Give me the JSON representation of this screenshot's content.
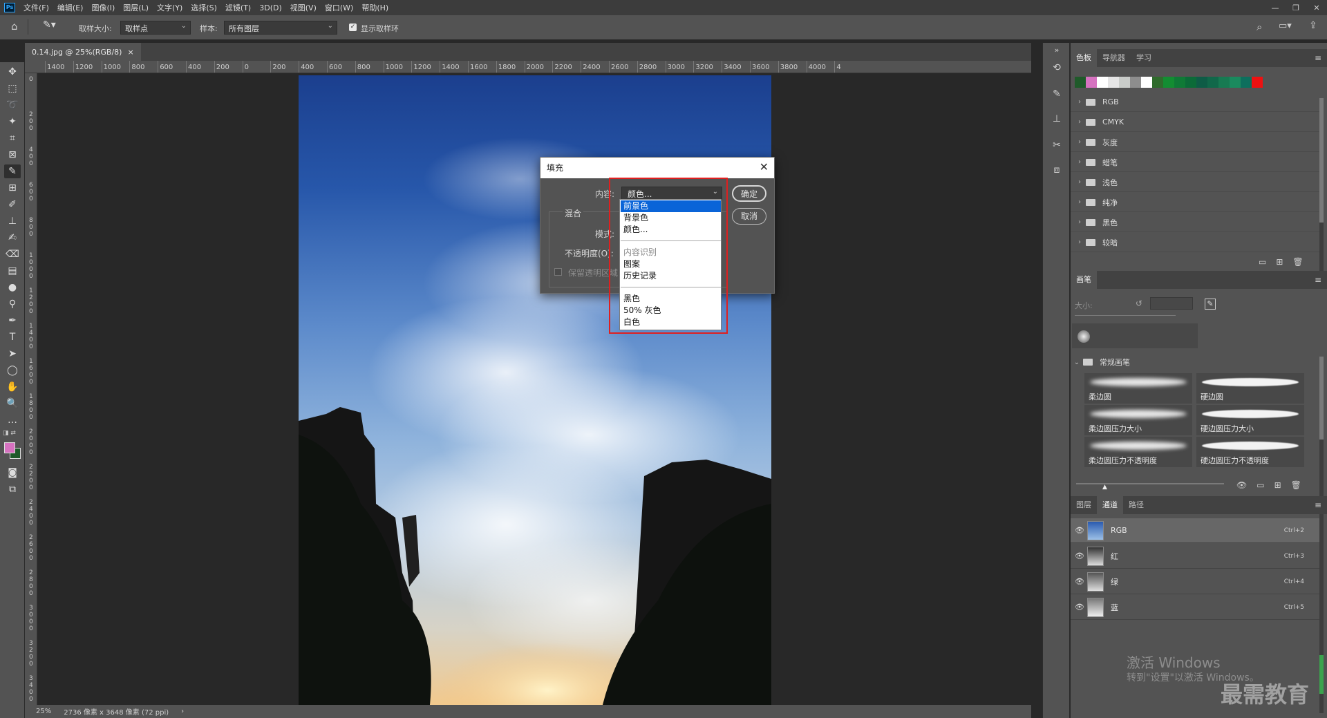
{
  "app": {
    "logo": "Ps"
  },
  "menu": [
    "文件(F)",
    "编辑(E)",
    "图像(I)",
    "图层(L)",
    "文字(Y)",
    "选择(S)",
    "滤镜(T)",
    "3D(D)",
    "视图(V)",
    "窗口(W)",
    "帮助(H)"
  ],
  "window_controls": [
    "—",
    "❐",
    "✕"
  ],
  "options_bar": {
    "sample_size_label": "取样大小:",
    "sample_size_value": "取样点",
    "sample_label": "样本:",
    "sample_value": "所有图层",
    "show_ring_label": "显示取样环",
    "show_ring_checked": true
  },
  "document": {
    "tab_title": "0.14.jpg @ 25%(RGB/8)",
    "close": "×",
    "zoom": "25%",
    "size_info": "2736 像素 x 3648 像素 (72 ppi)"
  },
  "ruler_top": [
    "1400",
    "1200",
    "1000",
    "800",
    "600",
    "400",
    "200",
    "0",
    "200",
    "400",
    "600",
    "800",
    "1000",
    "1200",
    "1400",
    "1600",
    "1800",
    "2000",
    "2200",
    "2400",
    "2600",
    "2800",
    "3000",
    "3200",
    "3400",
    "3600",
    "3800",
    "4000",
    "4"
  ],
  "ruler_left": [
    "0",
    "200",
    "400",
    "600",
    "800",
    "1000",
    "1200",
    "1400",
    "1600",
    "1800",
    "2000",
    "2200",
    "2400",
    "2600",
    "2800",
    "3000",
    "3200",
    "3400"
  ],
  "dialog": {
    "title": "填充",
    "content_label": "内容:",
    "content_value": "颜色...",
    "blend_label": "混合",
    "mode_label": "模式:",
    "opacity_label": "不透明度(O):",
    "preserve_label": "保留透明区域",
    "ok": "确定",
    "cancel": "取消",
    "options": [
      {
        "label": "前景色",
        "selected": true
      },
      {
        "label": "背景色"
      },
      {
        "label": "颜色..."
      },
      {
        "label": "内容识别",
        "disabled": true
      },
      {
        "label": "图案"
      },
      {
        "label": "历史记录"
      },
      {
        "label": "黑色"
      },
      {
        "label": "50% 灰色"
      },
      {
        "label": "白色"
      }
    ]
  },
  "swatches_panel": {
    "tabs": [
      "色板",
      "导航器",
      "学习"
    ],
    "colors": [
      "#1f5a2a",
      "#d672c0",
      "#ffffff",
      "#e5e5e5",
      "#c9ccc9",
      "#8d8d8d",
      "#ffffff",
      "#2f6b2c",
      "#138d32",
      "#0f7a36",
      "#0b6b38",
      "#0e5c46",
      "#11684a",
      "#177a52",
      "#1a8a5e",
      "#0d6f5d",
      "#ee1111"
    ],
    "groups": [
      "RGB",
      "CMYK",
      "灰度",
      "蜡笔",
      "浅色",
      "纯净",
      "黑色",
      "较暗"
    ]
  },
  "brush_panel": {
    "tab": "画笔",
    "size_label": "大小:",
    "group": "常规画笔",
    "brushes": [
      "柔边圆",
      "硬边圆",
      "柔边圆压力大小",
      "硬边圆压力大小",
      "柔边圆压力不透明度",
      "硬边圆压力不透明度"
    ]
  },
  "channels_panel": {
    "tabs": [
      "图层",
      "通道",
      "路径"
    ],
    "channels": [
      {
        "name": "RGB",
        "shortcut": "Ctrl+2"
      },
      {
        "name": "红",
        "shortcut": "Ctrl+3"
      },
      {
        "name": "绿",
        "shortcut": "Ctrl+4"
      },
      {
        "name": "蓝",
        "shortcut": "Ctrl+5"
      }
    ]
  },
  "watermark": {
    "line1": "激活 Windows",
    "line2": "转到\"设置\"以激活 Windows。",
    "brand": "最需教育"
  }
}
